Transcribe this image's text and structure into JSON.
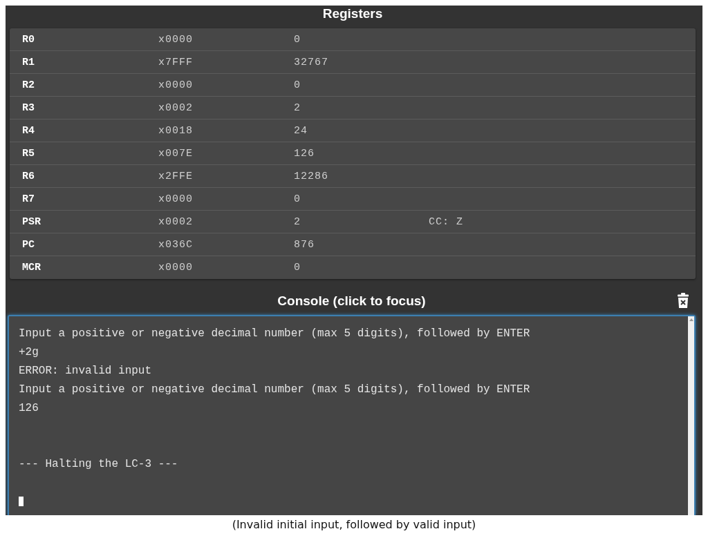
{
  "registers": {
    "title": "Registers",
    "rows": [
      {
        "name": "R0",
        "hex": "x0000",
        "decimal": "0"
      },
      {
        "name": "R1",
        "hex": "x7FFF",
        "decimal": "32767"
      },
      {
        "name": "R2",
        "hex": "x0000",
        "decimal": "0"
      },
      {
        "name": "R3",
        "hex": "x0002",
        "decimal": "2"
      },
      {
        "name": "R4",
        "hex": "x0018",
        "decimal": "24"
      },
      {
        "name": "R5",
        "hex": "x007E",
        "decimal": "126"
      },
      {
        "name": "R6",
        "hex": "x2FFE",
        "decimal": "12286"
      },
      {
        "name": "R7",
        "hex": "x0000",
        "decimal": "0"
      },
      {
        "name": "PSR",
        "hex": "x0002",
        "decimal": "2",
        "extra": "CC: Z"
      },
      {
        "name": "PC",
        "hex": "x036C",
        "decimal": "876"
      },
      {
        "name": "MCR",
        "hex": "x0000",
        "decimal": "0"
      }
    ]
  },
  "console": {
    "title": "Console (click to focus)",
    "lines": [
      {
        "kind": "text",
        "text": "Input a positive or negative decimal number (max 5 digits), followed by ENTER"
      },
      {
        "kind": "text",
        "text": "+2g"
      },
      {
        "kind": "text",
        "text": "ERROR: invalid input"
      },
      {
        "kind": "text",
        "text": "Input a positive or negative decimal number (max 5 digits), followed by ENTER"
      },
      {
        "kind": "text",
        "text": "126"
      },
      {
        "kind": "gap"
      },
      {
        "kind": "gap"
      },
      {
        "kind": "text",
        "text": "--- Halting the LC-3 ---"
      },
      {
        "kind": "gap"
      },
      {
        "kind": "cursor"
      }
    ]
  },
  "caption": "(Invalid initial input, followed by valid input)"
}
